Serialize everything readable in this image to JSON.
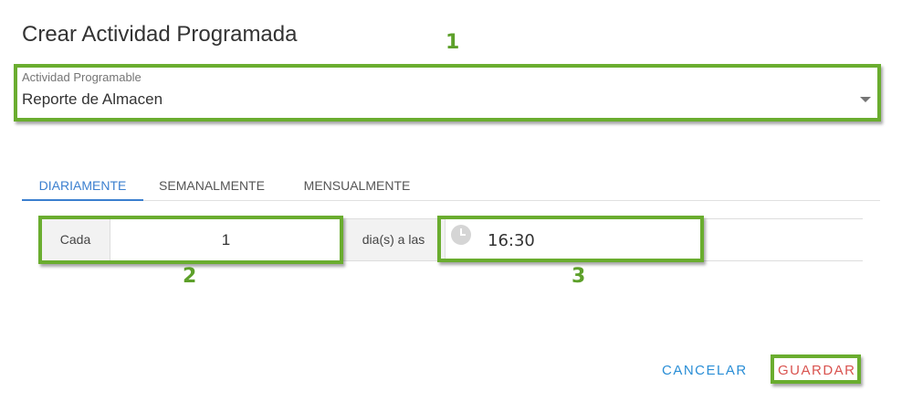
{
  "dialog": {
    "title": "Crear Actividad Programada"
  },
  "activity_select": {
    "label": "Actividad Programable",
    "value": "Reporte de Almacen"
  },
  "tabs": [
    {
      "label": "DIARIAMENTE",
      "active": true
    },
    {
      "label": "SEMANALMENTE",
      "active": false
    },
    {
      "label": "MENSUALMENTE",
      "active": false
    }
  ],
  "schedule": {
    "every_label": "Cada",
    "every_value": "1",
    "days_at_label": "dia(s) a las",
    "time_value": "16:30",
    "time_icon": "clock-icon"
  },
  "actions": {
    "cancel_label": "CANCELAR",
    "save_label": "GUARDAR"
  },
  "annotations": {
    "one": "1",
    "two": "2",
    "three": "3"
  },
  "colors": {
    "highlight": "#6aad2f",
    "tab_active": "#3b7fcf",
    "cancel": "#2a8ed6",
    "save": "#d9534f"
  }
}
